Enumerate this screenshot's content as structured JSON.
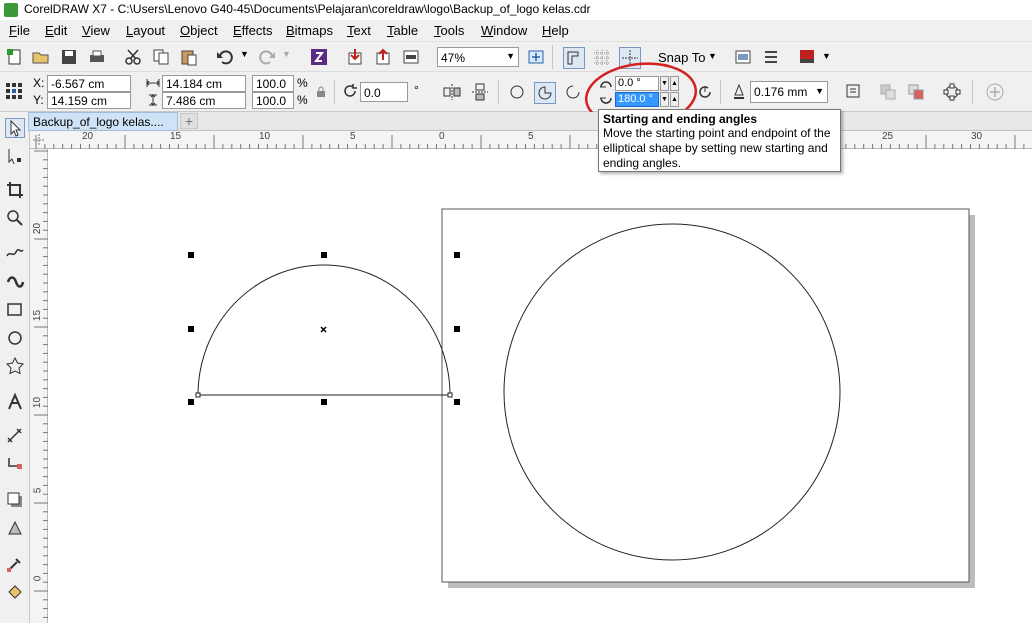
{
  "window": {
    "title": "CorelDRAW X7 - C:\\Users\\Lenovo G40-45\\Documents\\Pelajaran\\coreldraw\\logo\\Backup_of_logo kelas.cdr"
  },
  "menu": [
    "File",
    "Edit",
    "View",
    "Layout",
    "Object",
    "Effects",
    "Bitmaps",
    "Text",
    "Table",
    "Tools",
    "Window",
    "Help"
  ],
  "standard_toolbar": {
    "zoom_value": "47%",
    "snap_to_label": "Snap To"
  },
  "property_bar": {
    "x_label": "X:",
    "x_value": "-6.567 cm",
    "y_label": "Y:",
    "y_value": "14.159 cm",
    "width_value": "14.184 cm",
    "height_value": "7.486 cm",
    "scale_x": "100.0",
    "scale_y": "100.0",
    "percent_symbol": "%",
    "rotation_value": "0.0",
    "degree_symbol": "°",
    "start_angle": "0.0 °",
    "end_angle": "180.0 °",
    "outline_width": "0.176 mm"
  },
  "document_tabs": [
    {
      "label": "Backup_of_logo kelas...."
    }
  ],
  "tooltip": {
    "title": "Starting and ending angles",
    "description": "Move the starting point and endpoint of the elliptical shape by setting new starting and ending angles."
  },
  "rulers": {
    "horizontal_ticks": [
      "20",
      "15",
      "10",
      "5",
      "0",
      "5",
      "10",
      "15",
      "20",
      "25",
      "30"
    ],
    "vertical_ticks": [
      "20",
      "15",
      "10",
      "5",
      "0"
    ]
  },
  "colors": {
    "selection_handle": "#000000",
    "highlight_ring": "#d42020",
    "selected_field_bg": "#3399ff"
  }
}
